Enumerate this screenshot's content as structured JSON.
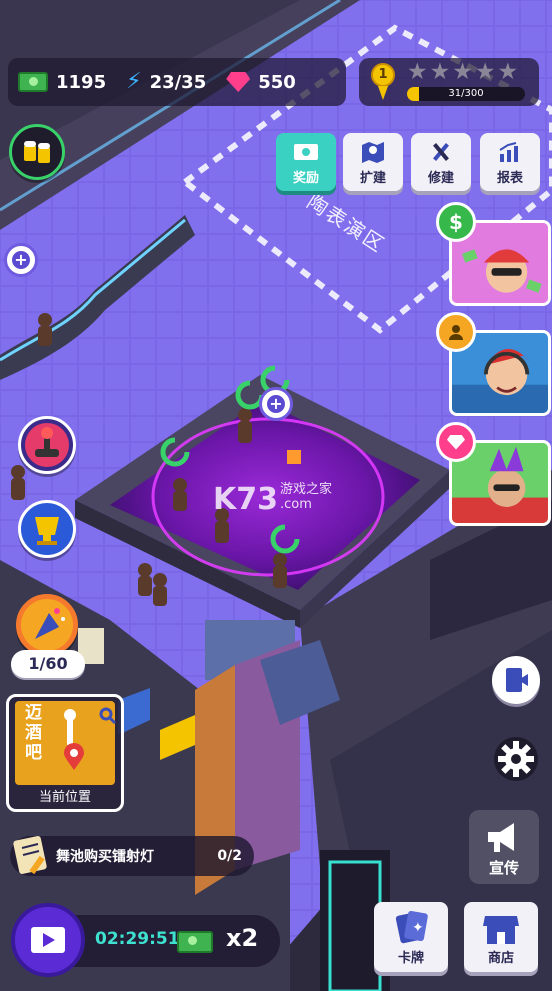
{
  "resources": {
    "cash": "1195",
    "energy": "23/35",
    "gems": "550"
  },
  "rating": {
    "level": "1",
    "stars_filled": 0,
    "stars_total": 5,
    "progress_text": "31/300",
    "progress": 0.1033
  },
  "top_actions": [
    {
      "label": "奖励",
      "icon": "reward-icon",
      "active": true
    },
    {
      "label": "扩建",
      "icon": "map-icon",
      "active": false
    },
    {
      "label": "修建",
      "icon": "tools-icon",
      "active": false
    },
    {
      "label": "报表",
      "icon": "chart-icon",
      "active": false
    }
  ],
  "floor_zone_label": "陶表演区",
  "watermark": {
    "brand": "K73",
    "site": "游戏之家",
    "domain": ".com"
  },
  "left_panel": {
    "counter": "1/60",
    "location_sign": "迈酒吧",
    "location_label": "当前位置"
  },
  "task": {
    "text": "舞池购买镭射灯",
    "count": "0/2"
  },
  "timer": {
    "time": "02:29:51",
    "multiplier": "x2"
  },
  "right_panel": {
    "promo_label": "宣传",
    "cards_label": "卡牌",
    "shop_label": "商店"
  },
  "colors": {
    "accent_teal": "#3ad1c3",
    "gold": "#f5c400",
    "gem_pink": "#ff3f8c",
    "floor_purple": "#7a67e8"
  }
}
